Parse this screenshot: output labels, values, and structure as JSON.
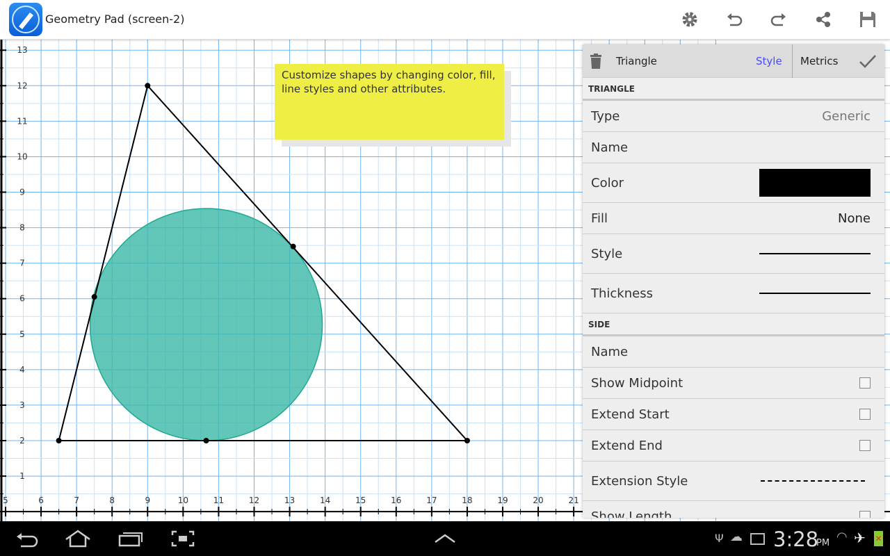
{
  "app": {
    "title": "Geometry Pad (screen-2)",
    "icons": [
      "settings-icon",
      "undo-icon",
      "redo-icon",
      "share-icon",
      "save-icon"
    ]
  },
  "canvas": {
    "x_ticks": [
      5,
      6,
      7,
      8,
      9,
      10,
      11,
      12,
      13,
      14,
      15,
      16,
      17,
      18,
      19,
      20,
      21
    ],
    "y_ticks": [
      1,
      2,
      3,
      4,
      5,
      6,
      7,
      8,
      9,
      10,
      11,
      12,
      13
    ],
    "triangle": [
      [
        6.5,
        2
      ],
      [
        9,
        12
      ],
      [
        18,
        2
      ]
    ],
    "incircle": {
      "center": [
        10.65,
        5.27
      ],
      "radius": 3.27,
      "fill": "#3bb8a6"
    },
    "points": [
      [
        6.5,
        2
      ],
      [
        9,
        12
      ],
      [
        18,
        2
      ],
      [
        7.5,
        6.05
      ],
      [
        13.1,
        7.47
      ],
      [
        10.65,
        2
      ]
    ],
    "grid_color": "#6fb5f0"
  },
  "note": {
    "text": "Customize shapes by changing color, fill, line styles and other attributes."
  },
  "panel": {
    "shape": "Triangle",
    "tab_style": "Style",
    "tab_metrics": "Metrics",
    "style_color": "#4a4aff",
    "section1": "TRIANGLE",
    "type_label": "Type",
    "type_value": "Generic",
    "name_label": "Name",
    "color_label": "Color",
    "color_value": "#000000",
    "fill_label": "Fill",
    "fill_value": "None",
    "style_label": "Style",
    "thickness_label": "Thickness",
    "section2": "SIDE",
    "side_name_label": "Name",
    "show_midpoint": "Show Midpoint",
    "extend_start": "Extend Start",
    "extend_end": "Extend End",
    "extension_style": "Extension Style",
    "show_length": "Show Length"
  },
  "status": {
    "time": "3:28",
    "ampm": "PM"
  }
}
